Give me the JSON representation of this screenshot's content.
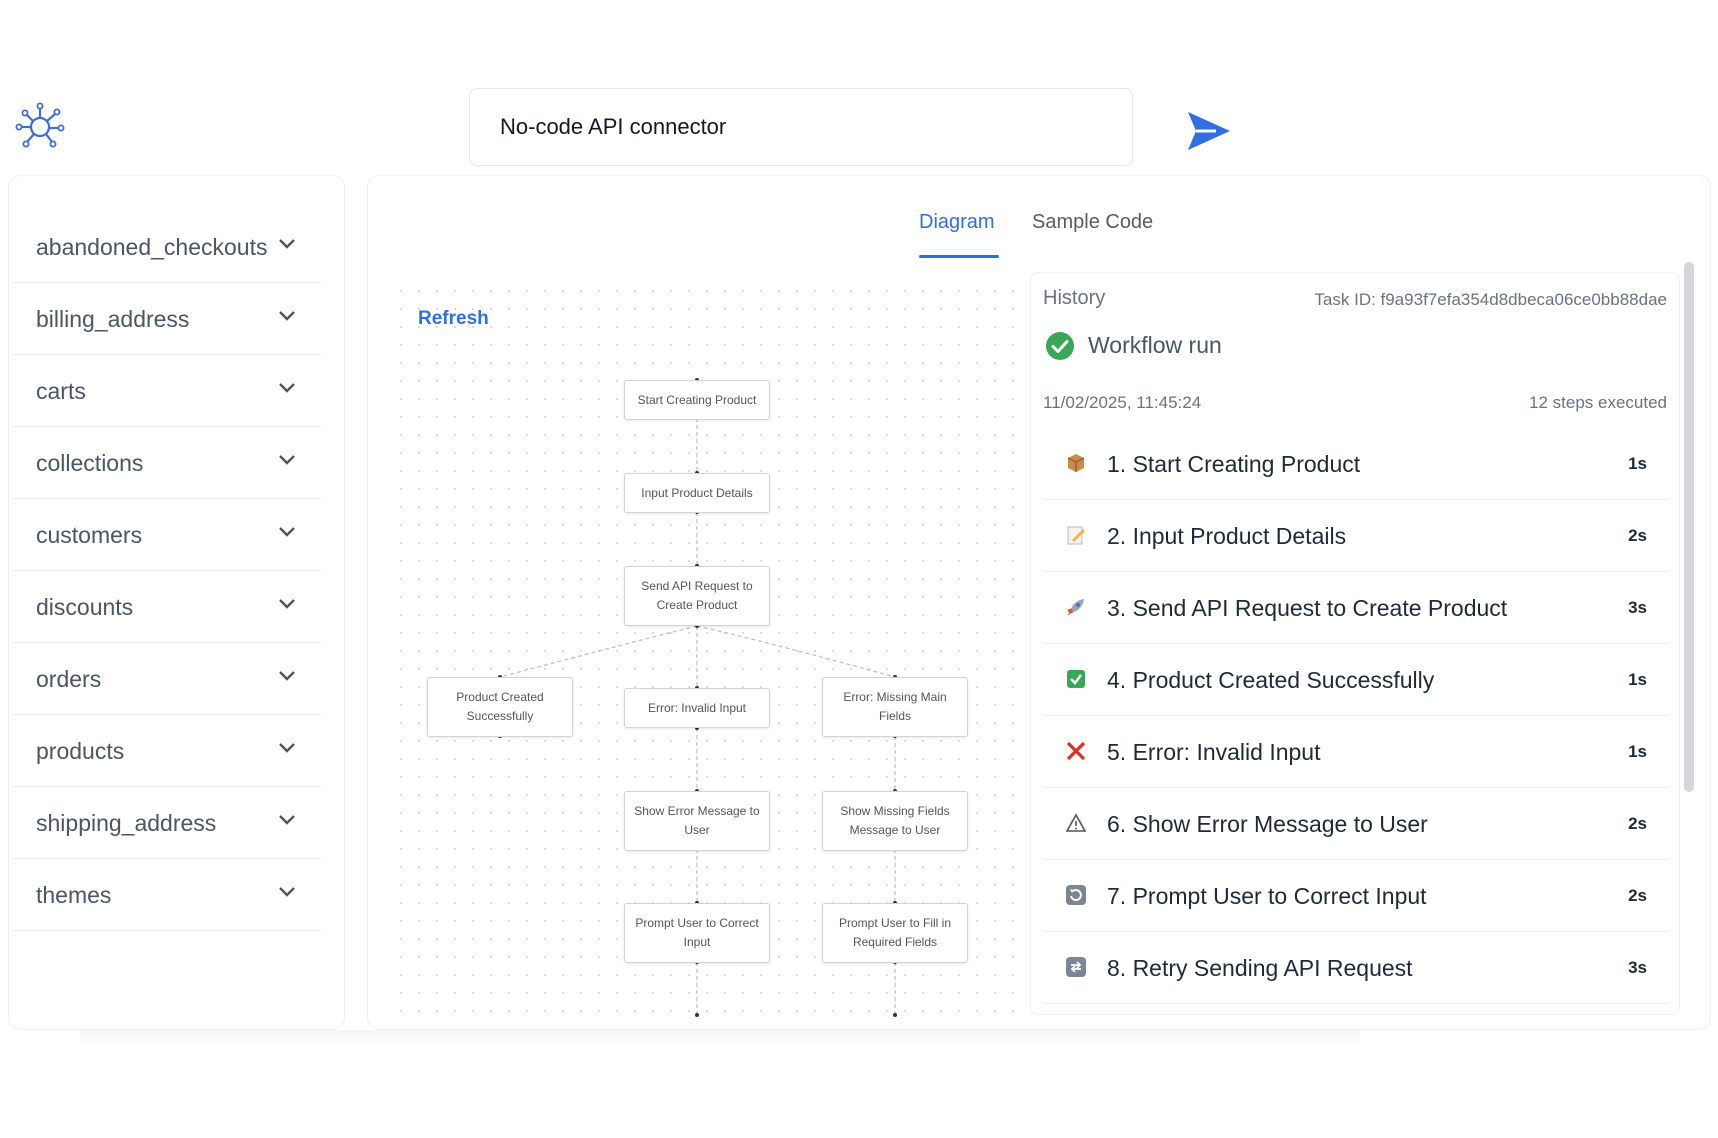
{
  "header": {
    "prompt_text": "No-code API connector",
    "logo_icon": "hub-network-icon",
    "send_icon": "send-arrow-icon"
  },
  "sidebar": {
    "items": [
      {
        "label": "abandoned_checkouts"
      },
      {
        "label": "billing_address"
      },
      {
        "label": "carts"
      },
      {
        "label": "collections"
      },
      {
        "label": "customers"
      },
      {
        "label": "discounts"
      },
      {
        "label": "orders"
      },
      {
        "label": "products"
      },
      {
        "label": "shipping_address"
      },
      {
        "label": "themes"
      }
    ]
  },
  "tabs": [
    {
      "label": "Diagram",
      "active": true
    },
    {
      "label": "Sample Code",
      "active": false
    }
  ],
  "diagram": {
    "refresh_label": "Refresh",
    "nodes": [
      {
        "label": "Start Creating Product"
      },
      {
        "label": "Input Product Details"
      },
      {
        "label": "Send API Request to Create Product"
      },
      {
        "label": "Product Created Successfully"
      },
      {
        "label": "Error: Invalid Input"
      },
      {
        "label": "Error: Missing Main Fields"
      },
      {
        "label": "Show Error Message to User"
      },
      {
        "label": "Show Missing Fields Message to User"
      },
      {
        "label": "Prompt User to Correct Input"
      },
      {
        "label": "Prompt User to Fill in Required Fields"
      }
    ]
  },
  "history": {
    "title": "History",
    "task_id": "Task ID: f9a93f7efa354d8dbeca06ce0bb88dae",
    "workflow_label": "Workflow run",
    "timestamp": "11/02/2025, 11:45:24",
    "steps_executed": "12 steps executed",
    "steps": [
      {
        "label": "1. Start Creating Product",
        "duration": "1s",
        "icon": "package-icon"
      },
      {
        "label": "2. Input Product Details",
        "duration": "2s",
        "icon": "memo-icon"
      },
      {
        "label": "3. Send API Request to Create Product",
        "duration": "3s",
        "icon": "rocket-icon"
      },
      {
        "label": "4. Product Created Successfully",
        "duration": "1s",
        "icon": "check-box-icon"
      },
      {
        "label": "5. Error: Invalid Input",
        "duration": "1s",
        "icon": "cross-mark-icon"
      },
      {
        "label": "6. Show Error Message to User",
        "duration": "2s",
        "icon": "warning-icon"
      },
      {
        "label": "7. Prompt User to Correct Input",
        "duration": "2s",
        "icon": "repeat-icon"
      },
      {
        "label": "8. Retry Sending API Request",
        "duration": "3s",
        "icon": "retry-icon"
      }
    ]
  },
  "colors": {
    "accent": "#2f6fe0",
    "success": "#3aa757",
    "error": "#d93025"
  }
}
